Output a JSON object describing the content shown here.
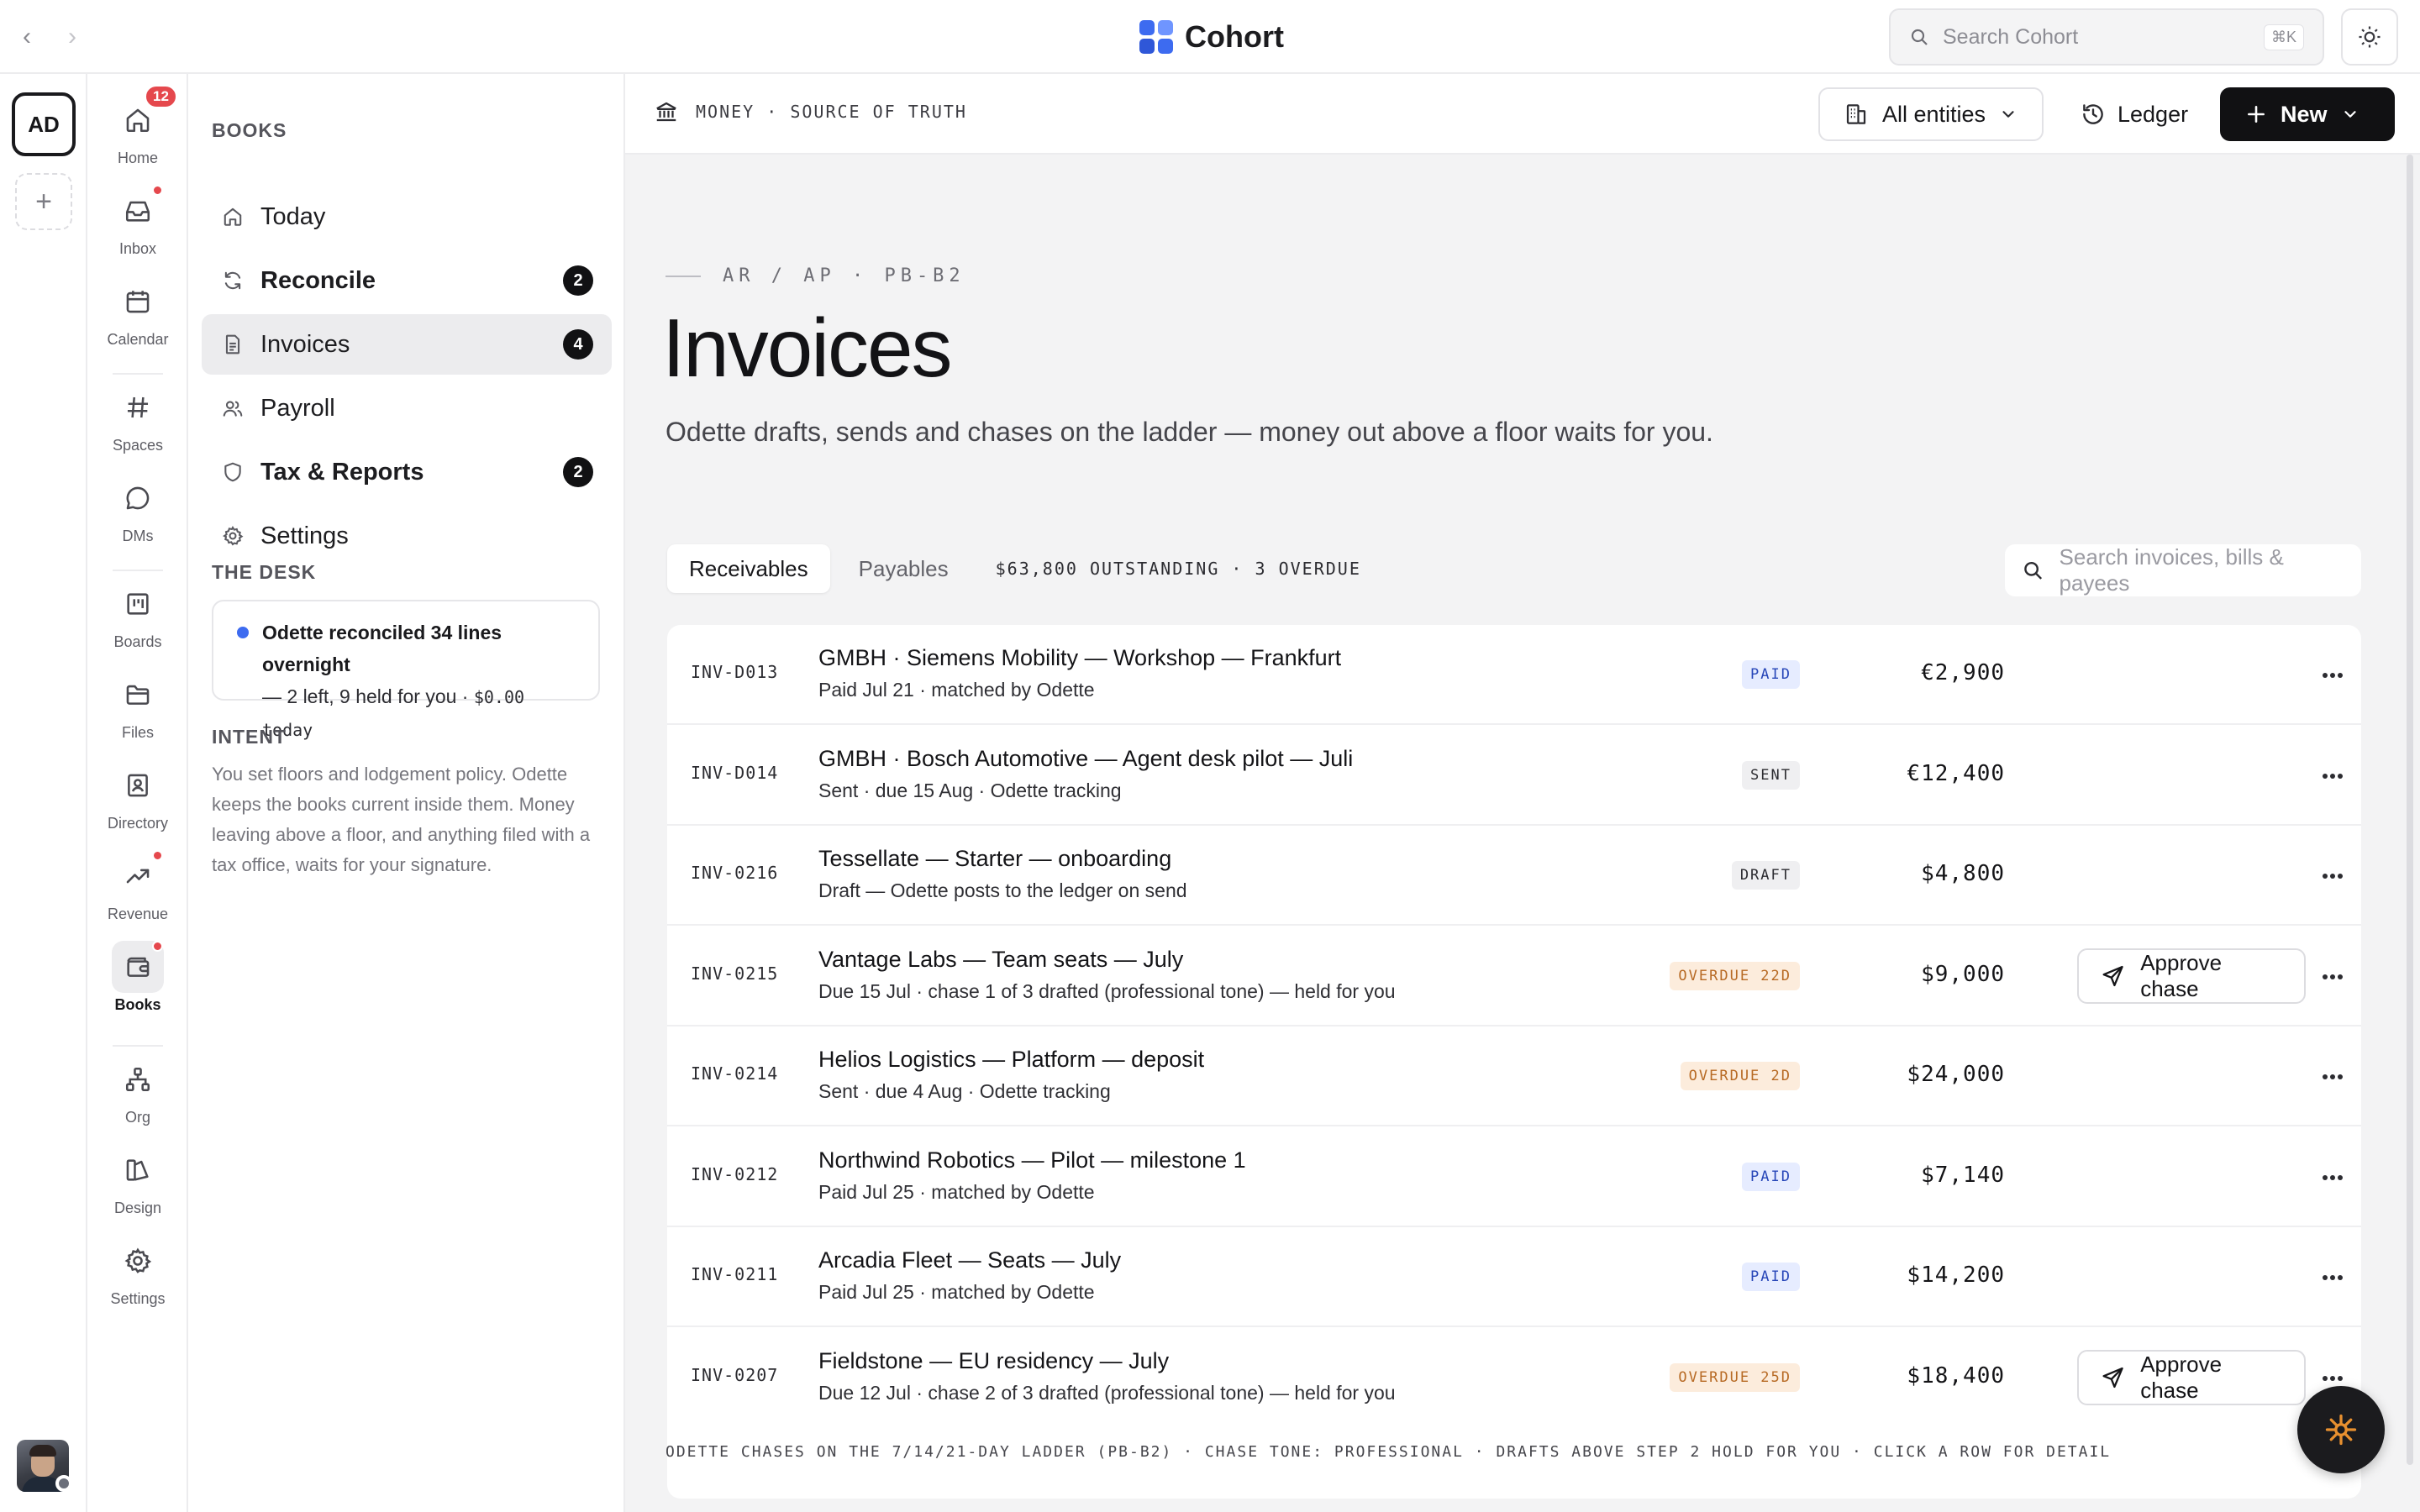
{
  "topbar": {
    "brand": "Cohort",
    "search_placeholder": "Search Cohort",
    "search_shortcut": "⌘K"
  },
  "workspace": {
    "initials": "AD",
    "add_label": "+"
  },
  "apprail": {
    "items": [
      {
        "label": "Home",
        "icon": "home-icon",
        "badge": "12"
      },
      {
        "label": "Inbox",
        "icon": "inbox-icon",
        "dot": true
      },
      {
        "label": "Calendar",
        "icon": "calendar-icon"
      },
      {
        "label": "Spaces",
        "icon": "hash-icon"
      },
      {
        "label": "DMs",
        "icon": "chat-bubble-icon"
      },
      {
        "label": "Boards",
        "icon": "board-icon"
      },
      {
        "label": "Files",
        "icon": "folder-icon"
      },
      {
        "label": "Directory",
        "icon": "contact-card-icon"
      },
      {
        "label": "Revenue",
        "icon": "trend-up-icon",
        "dot": true
      },
      {
        "label": "Books",
        "icon": "wallet-icon",
        "dot": true,
        "active": true
      },
      {
        "label": "Org",
        "icon": "org-chart-icon"
      },
      {
        "label": "Design",
        "icon": "design-icon"
      },
      {
        "label": "Settings",
        "icon": "gear-icon"
      }
    ]
  },
  "books": {
    "section_title": "BOOKS",
    "nav": [
      {
        "label": "Today",
        "icon": "home-icon"
      },
      {
        "label": "Reconcile",
        "icon": "refresh-icon",
        "badge": "2",
        "bold": true
      },
      {
        "label": "Invoices",
        "icon": "document-icon",
        "badge": "4",
        "active": true
      },
      {
        "label": "Payroll",
        "icon": "people-icon"
      },
      {
        "label": "Tax & Reports",
        "icon": "shield-icon",
        "badge": "2",
        "bold": true
      },
      {
        "label": "Settings",
        "icon": "gear-icon"
      }
    ],
    "desk_title": "THE DESK",
    "desk_card": {
      "headline": "Odette reconciled 34 lines overnight",
      "detail": "— 2 left, 9 held for you · ",
      "amount": "$0.00 today"
    },
    "intent_title": "INTENT",
    "intent_text": "You set floors and lodgement policy. Odette keeps the books current inside them. Money leaving above a floor, and anything filed with a tax office, waits for your signature."
  },
  "main": {
    "crumb": "MONEY · SOURCE OF TRUTH",
    "entities_label": "All entities",
    "ledger_label": "Ledger",
    "new_label": "New",
    "eyebrow": "AR / AP · PB-B2",
    "title": "Invoices",
    "subtitle": "Odette drafts, sends and chases on the ladder — money out above a floor waits for you.",
    "tabs": [
      "Receivables",
      "Payables"
    ],
    "summary": "$63,800 OUTSTANDING · 3 OVERDUE",
    "search_placeholder": "Search invoices, bills & payees",
    "footnote": "ODETTE CHASES ON THE 7/14/21-DAY LADDER (PB-B2) · CHASE TONE: PROFESSIONAL · DRAFTS ABOVE STEP 2 HOLD FOR YOU · CLICK A ROW FOR DETAIL"
  },
  "invoices": [
    {
      "id": "INV-D013",
      "title": "GMBH · Siemens Mobility — Workshop — Frankfurt",
      "sub": "Paid Jul 21 · matched by Odette",
      "status": "PAID",
      "status_kind": "paid",
      "amount": "€2,900",
      "action": ""
    },
    {
      "id": "INV-D014",
      "title": "GMBH · Bosch Automotive — Agent desk pilot — Juli",
      "sub": "Sent · due 15 Aug · Odette tracking",
      "status": "SENT",
      "status_kind": "sent",
      "amount": "€12,400",
      "action": ""
    },
    {
      "id": "INV-0216",
      "title": "Tessellate — Starter — onboarding",
      "sub": "Draft — Odette posts to the ledger on send",
      "status": "DRAFT",
      "status_kind": "draft",
      "amount": "$4,800",
      "action": ""
    },
    {
      "id": "INV-0215",
      "title": "Vantage Labs — Team seats — July",
      "sub": "Due 15 Jul · chase 1 of 3 drafted (professional tone) — held for you",
      "status": "OVERDUE 22D",
      "status_kind": "overdue",
      "amount": "$9,000",
      "action": "Approve chase"
    },
    {
      "id": "INV-0214",
      "title": "Helios Logistics — Platform — deposit",
      "sub": "Sent · due 4 Aug · Odette tracking",
      "status": "OVERDUE 2D",
      "status_kind": "overdue",
      "amount": "$24,000",
      "action": ""
    },
    {
      "id": "INV-0212",
      "title": "Northwind Robotics — Pilot — milestone 1",
      "sub": "Paid Jul 25 · matched by Odette",
      "status": "PAID",
      "status_kind": "paid",
      "amount": "$7,140",
      "action": ""
    },
    {
      "id": "INV-0211",
      "title": "Arcadia Fleet — Seats — July",
      "sub": "Paid Jul 25 · matched by Odette",
      "status": "PAID",
      "status_kind": "paid",
      "amount": "$14,200",
      "action": ""
    },
    {
      "id": "INV-0207",
      "title": "Fieldstone — EU residency — July",
      "sub": "Due 12 Jul · chase 2 of 3 drafted (professional tone) — held for you",
      "status": "OVERDUE 25D",
      "status_kind": "overdue",
      "amount": "$18,400",
      "action": "Approve chase"
    }
  ],
  "colors": {
    "brand": "#3d6bf0",
    "alert": "#e5484d",
    "paid_bg": "#e6ecff",
    "overdue_bg": "#fcecdc",
    "overdue_text": "#b76a24",
    "fab_accent": "#e8902f"
  }
}
